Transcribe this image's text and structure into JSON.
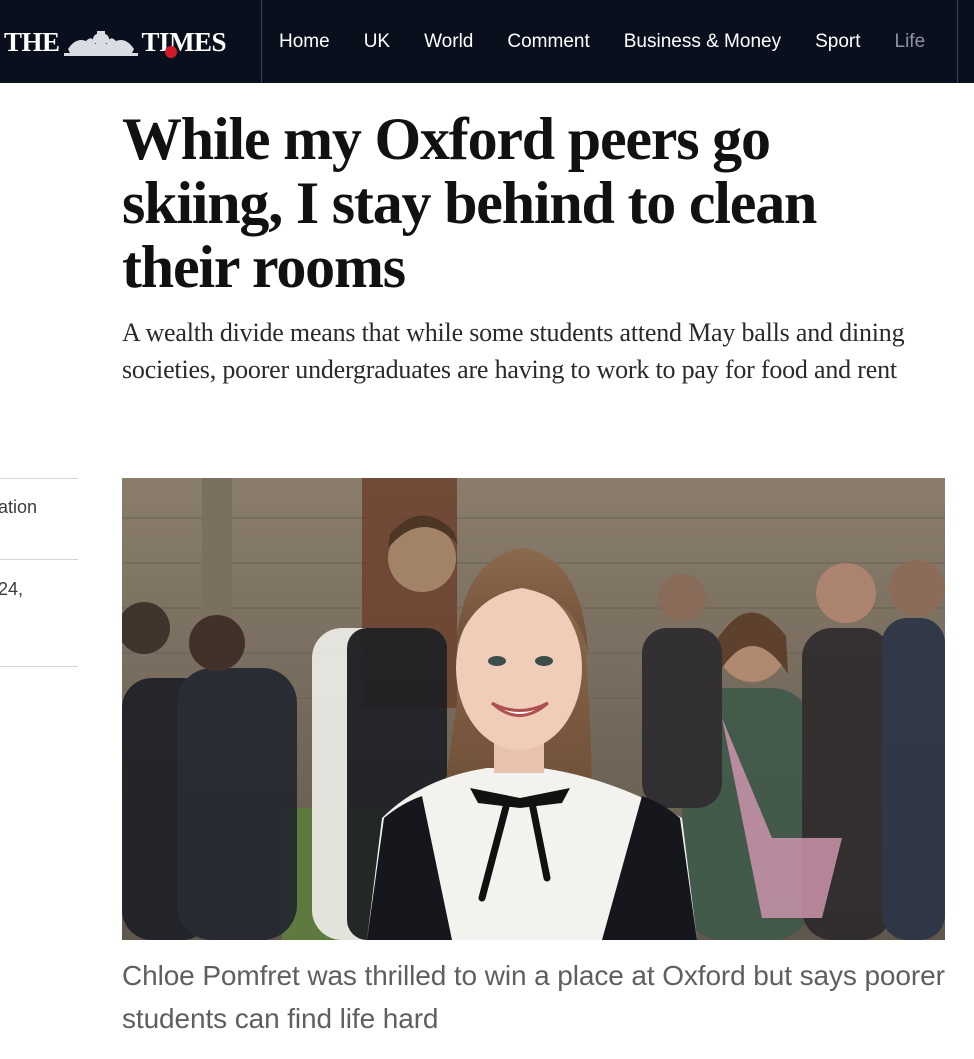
{
  "header": {
    "masthead_left": "THE",
    "masthead_right_a": "TI",
    "masthead_right_b": "MES",
    "logo_icon": "royal-crest-icon",
    "nav_items": [
      {
        "label": "Home"
      },
      {
        "label": "UK"
      },
      {
        "label": "World"
      },
      {
        "label": "Comment"
      },
      {
        "label": "Business & Money"
      },
      {
        "label": "Sport"
      },
      {
        "label": "Life"
      }
    ]
  },
  "article": {
    "headline": "While my Oxford peers go skiing, I stay behind to clean their rooms",
    "standfirst": "A wealth divide means that while some students attend May balls and dining societies, poorer undergraduates are having to work to pay for food and rent",
    "image_caption": "Chloe Pomfret was thrilled to win a place at Oxford but says poorer students can find life hard"
  },
  "rail": {
    "item_1": "ation",
    "item_2": "24,"
  },
  "colors": {
    "nav_background": "#0a0f1e",
    "headline": "#111111",
    "caption": "#5f5f5f",
    "rose_accent": "#d11a2a"
  }
}
